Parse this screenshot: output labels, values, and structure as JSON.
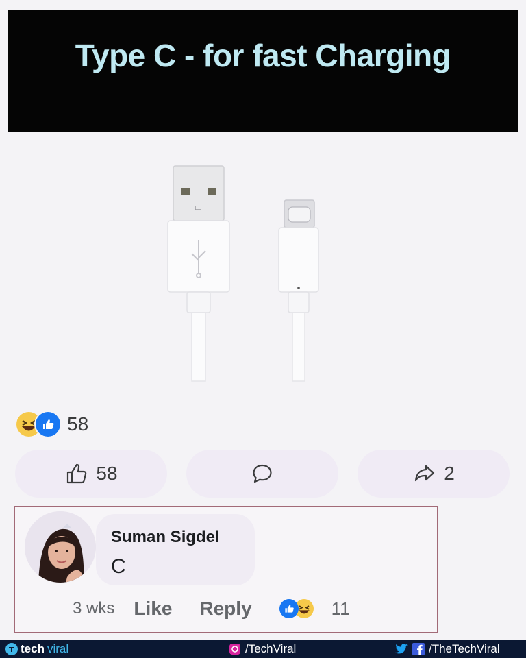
{
  "banner": {
    "title": "Type C - for fast Charging"
  },
  "post": {
    "reaction_count": "58",
    "actions": {
      "like_count": "58",
      "share_count": "2"
    }
  },
  "comment": {
    "author": "Suman Sigdel",
    "text": "C",
    "time": "3 wks",
    "like_label": "Like",
    "reply_label": "Reply",
    "reaction_count": "11"
  },
  "footer": {
    "brand_a": "tech",
    "brand_b": "viral",
    "instagram": "/TechViral",
    "facebook": "/TheTechViral"
  },
  "colors": {
    "banner_bg": "#050505",
    "banner_text": "#bfe9f2",
    "like_blue": "#1877f2",
    "haha_yellow": "#f6c94a",
    "highlight_border": "#a26a77",
    "footer_bg": "#0b1833"
  },
  "icons": [
    "haha-emoji-icon",
    "like-emoji-icon",
    "thumbs-up-icon",
    "comment-icon",
    "share-icon",
    "instagram-icon",
    "twitter-icon",
    "facebook-icon"
  ]
}
